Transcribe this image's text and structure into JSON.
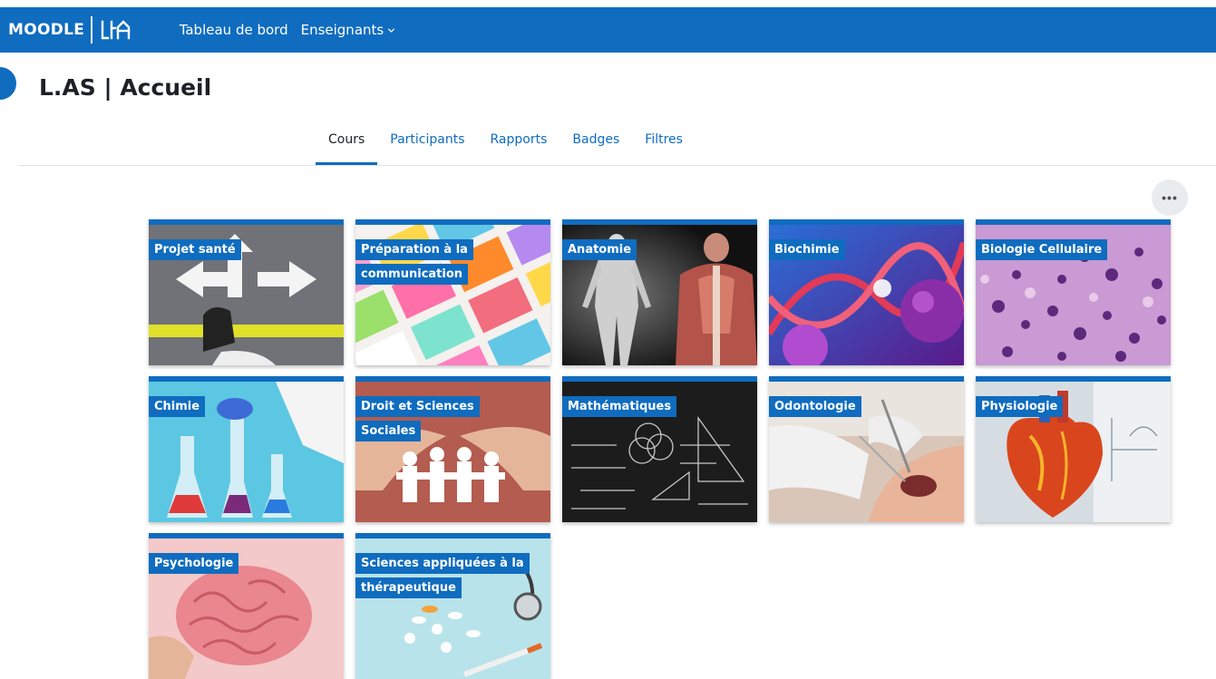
{
  "navbar": {
    "brand": "MOODLE",
    "links": [
      {
        "label": "Tableau de bord"
      },
      {
        "label": "Enseignants"
      }
    ]
  },
  "page": {
    "title": "L.AS | Accueil"
  },
  "tabs": [
    {
      "label": "Cours",
      "active": true
    },
    {
      "label": "Participants"
    },
    {
      "label": "Rapports"
    },
    {
      "label": "Badges"
    },
    {
      "label": "Filtres"
    }
  ],
  "more_button": "•••",
  "courses": [
    {
      "name": "Projet santé",
      "image": "road-arrows-sneakers"
    },
    {
      "name": "Préparation à la communication",
      "image": "colorful-speech-bubbles"
    },
    {
      "name": "Anatomie",
      "image": "human-muscles"
    },
    {
      "name": "Biochimie",
      "image": "dna-helix"
    },
    {
      "name": "Biologie Cellulaire",
      "image": "stained-cells"
    },
    {
      "name": "Chimie",
      "image": "lab-flasks"
    },
    {
      "name": "Droit et Sciences Sociales",
      "image": "paper-people-hands"
    },
    {
      "name": "Mathématiques",
      "image": "chalkboard-formulas"
    },
    {
      "name": "Odontologie",
      "image": "dental-treatment"
    },
    {
      "name": "Physiologie",
      "image": "heart-model"
    },
    {
      "name": "Psychologie",
      "image": "brain-model"
    },
    {
      "name": "Sciences appliquées à la thérapeutique",
      "image": "pills-stethoscope"
    }
  ],
  "colors": {
    "brand": "#0f6cbf",
    "text": "#1d2125"
  }
}
